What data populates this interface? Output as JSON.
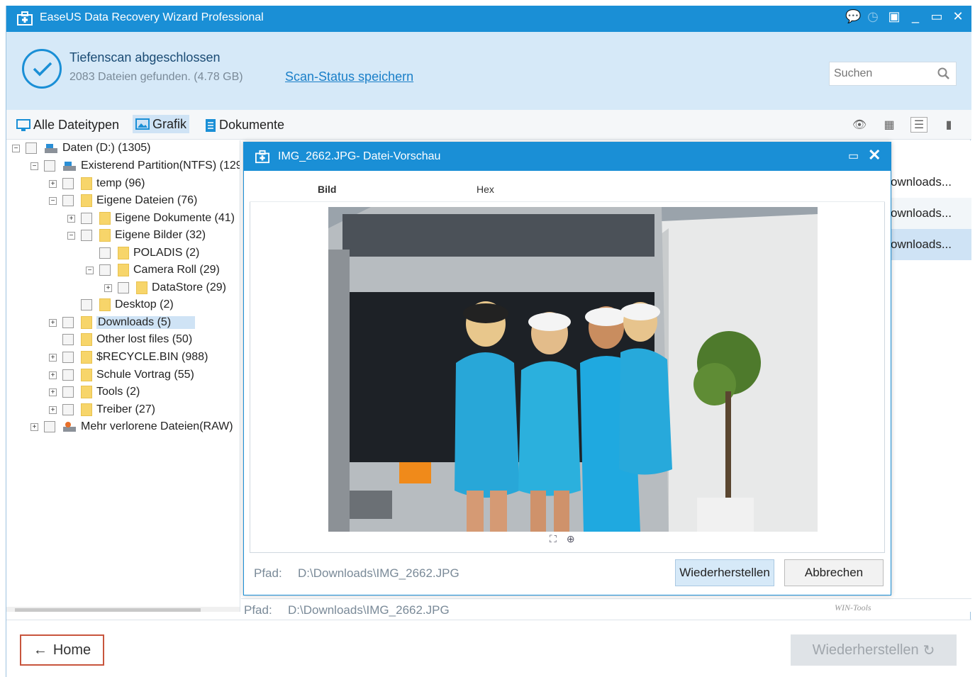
{
  "window": {
    "title": "EaseUS Data Recovery Wizard Professional"
  },
  "status": {
    "headline": "Tiefenscan abgeschlossen",
    "summary": "2083 Dateien gefunden. (4.78 GB)",
    "save_link": "Scan-Status speichern",
    "search_placeholder": "Suchen"
  },
  "filters": [
    {
      "label": "Alle Dateitypen",
      "icon": "monitor-icon"
    },
    {
      "label": "Grafik",
      "icon": "image-icon"
    },
    {
      "label": "Dokumente",
      "icon": "document-icon"
    }
  ],
  "tree": [
    {
      "label": "Daten (D:) (1305)",
      "icon": "drive-icon",
      "expanded": true
    },
    {
      "label": "Existerend Partition(NTFS) (129",
      "icon": "drive-icon",
      "expanded": true
    },
    {
      "label": "temp (96)",
      "icon": "folder-icon",
      "expanded": false
    },
    {
      "label": "Eigene Dateien (76)",
      "icon": "folder-icon",
      "expanded": true
    },
    {
      "label": "Eigene Dokumente (41)",
      "icon": "folder-icon",
      "expanded": false
    },
    {
      "label": "Eigene Bilder (32)",
      "icon": "folder-icon",
      "expanded": true
    },
    {
      "label": "POLADIS (2)",
      "icon": "folder-icon"
    },
    {
      "label": "Camera Roll (29)",
      "icon": "folder-icon",
      "expanded": true
    },
    {
      "label": "DataStore (29)",
      "icon": "folder-icon",
      "expanded": false
    },
    {
      "label": "Desktop (2)",
      "icon": "folder-icon"
    },
    {
      "label": "Downloads (5)",
      "icon": "folder-icon",
      "expanded": false,
      "selected": true
    },
    {
      "label": "Other lost files (50)",
      "icon": "folder-icon"
    },
    {
      "label": "$RECYCLE.BIN (988)",
      "icon": "folder-icon",
      "expanded": false
    },
    {
      "label": "Schule Vortrag (55)",
      "icon": "folder-icon",
      "expanded": false
    },
    {
      "label": "Tools (2)",
      "icon": "folder-icon",
      "expanded": false
    },
    {
      "label": "Treiber (27)",
      "icon": "folder-icon",
      "expanded": false
    },
    {
      "label": "Mehr verlorene Dateien(RAW)",
      "icon": "raw-drive-icon",
      "expanded": false
    }
  ],
  "list_rows": [
    "ownloads...",
    "ownloads...",
    "ownloads..."
  ],
  "path": {
    "label": "Pfad:",
    "value": "D:\\Downloads\\IMG_2662.JPG"
  },
  "watermark": "WIN-Tools",
  "bottom": {
    "home_label": "Home",
    "recover_label": "Wiederherstellen"
  },
  "preview": {
    "title": "IMG_2662.JPG- Datei-Vorschau",
    "tabs": [
      "Bild",
      "Hex"
    ],
    "path_label": "Pfad:",
    "path_value": "D:\\Downloads\\IMG_2662.JPG",
    "restore_label": "Wiederherstellen",
    "cancel_label": "Abbrechen"
  },
  "colors": {
    "accent": "#1a8fd6",
    "header_bg": "#d6e9f8",
    "selection": "#cfe3f5"
  }
}
